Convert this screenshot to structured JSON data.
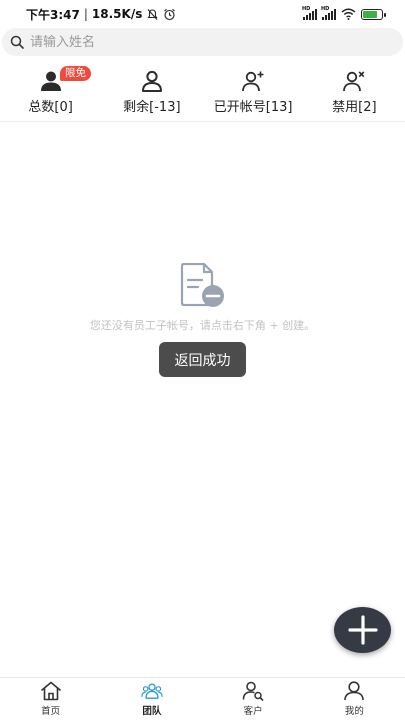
{
  "status_bar": {
    "time": "下午3:47",
    "speed": "18.5K/s",
    "signal_label_1": "HD",
    "signal_label_2": "HD",
    "battery_color": "#3cb043"
  },
  "search": {
    "placeholder": "请输入姓名",
    "icon": "search-icon"
  },
  "stats": [
    {
      "label": "总数[0]",
      "badge": "限免",
      "icon": "person-filled-icon"
    },
    {
      "label": "剩余[-13]",
      "icon": "person-outline-icon"
    },
    {
      "label": "已开帐号[13]",
      "icon": "person-add-icon"
    },
    {
      "label": "禁用[2]",
      "icon": "person-disabled-icon"
    }
  ],
  "empty_state": {
    "text": "您还没有员工子帐号，请点击右下角 + 创建。",
    "icon": "document-minus-icon"
  },
  "toast": {
    "text": "返回成功"
  },
  "fab": {
    "icon": "plus-icon"
  },
  "bottom_nav": [
    {
      "label": "首页",
      "icon": "home-icon",
      "active": false
    },
    {
      "label": "团队",
      "icon": "team-icon",
      "active": true
    },
    {
      "label": "客户",
      "icon": "customer-search-icon",
      "active": false
    },
    {
      "label": "我的",
      "icon": "profile-icon",
      "active": false
    }
  ],
  "colors": {
    "accent": "#2f9bd6",
    "badge": "#f04a3f",
    "toast_bg": "#4c4c4c",
    "fab_bg": "#353a44"
  }
}
